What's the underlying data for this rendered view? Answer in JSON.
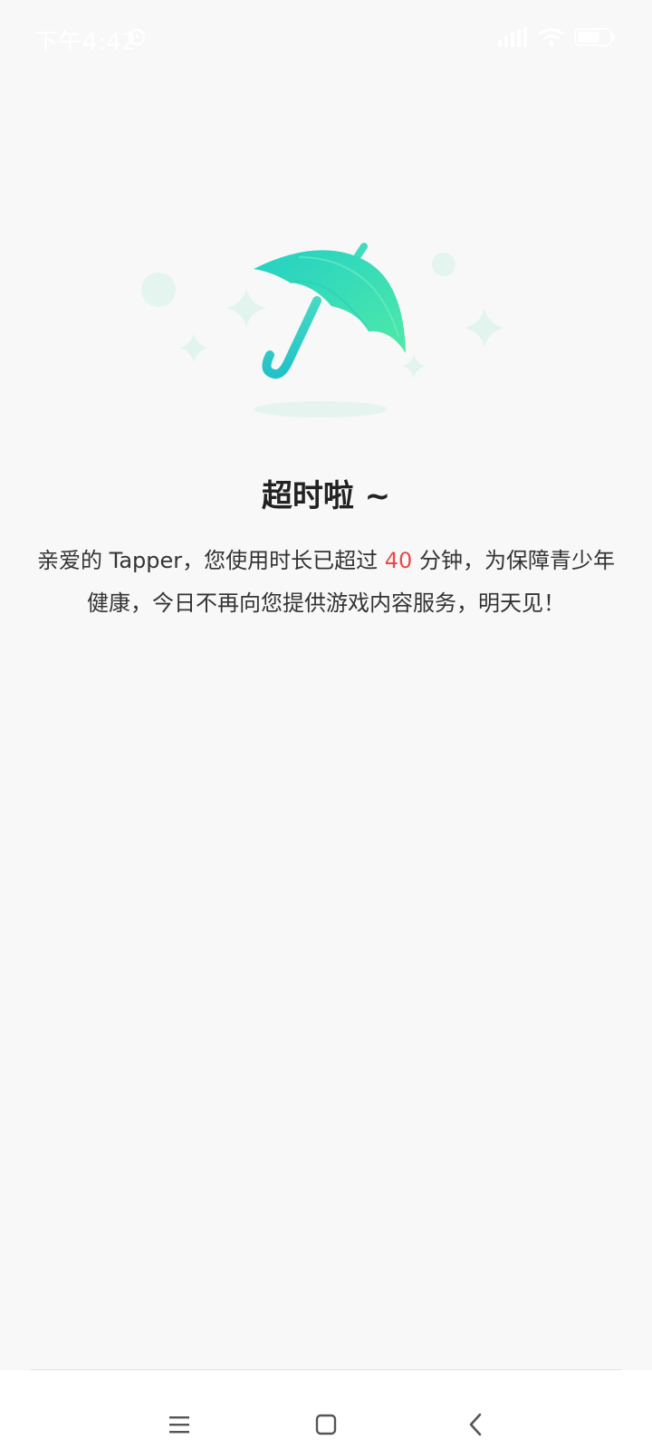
{
  "status_bar": {
    "time": "下午4:42",
    "alarm_icon": "alarm-icon",
    "signal_icon": "signal-icon",
    "wifi_icon": "wifi-icon",
    "battery_icon": "battery-icon",
    "battery_level": "63"
  },
  "illustration": {
    "icon": "umbrella-icon",
    "colors": {
      "umbrella_light": "#3ee6b3",
      "umbrella_dark": "#1fc9c3",
      "sparkle": "#e2f4ee",
      "shadow": "#e6f4ef"
    }
  },
  "content": {
    "title": "超时啦 ~",
    "message_part1": "亲爱的 Tapper，您使用时长已超过 ",
    "minutes": "40",
    "message_part2": " 分钟，为保障青少年健康，今日不再向您提供游戏内容服务，明天见！",
    "highlight_color": "#e84a4a"
  },
  "nav_bar": {
    "menu_icon": "menu-icon",
    "home_icon": "home-icon",
    "back_icon": "back-icon"
  }
}
